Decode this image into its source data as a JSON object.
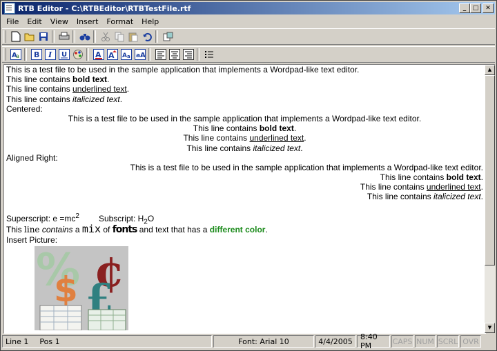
{
  "window": {
    "title": "RTB Editor - C:\\RTBEditor\\RTBTestFile.rtf",
    "minimize": "_",
    "maximize": "□",
    "close": "✕"
  },
  "menu": [
    "File",
    "Edit",
    "View",
    "Insert",
    "Format",
    "Help"
  ],
  "toolbar1": [
    "new-icon",
    "open-icon",
    "save-icon",
    "print-icon",
    "find-icon",
    "cut-icon",
    "copy-icon",
    "paste-icon",
    "undo-icon",
    "insert-object-icon"
  ],
  "toolbar2": [
    "font-icon",
    "bold-icon",
    "italic-icon",
    "underline-icon",
    "color-icon",
    "text-color-icon",
    "font-size-up-icon",
    "font-size-down-icon",
    "font-select-icon",
    "align-left-icon",
    "align-center-icon",
    "align-right-icon",
    "bullets-icon"
  ],
  "doc": {
    "l1": "This is a test file to be used in the sample application that implements a Wordpad-like text editor.",
    "contains": "This line contains ",
    "bold": "bold text",
    "underlined": "underlined text",
    "italic": "italicized text",
    "dot": ".",
    "centered": "Centered:",
    "right": "Aligned Right:",
    "sup_label": "Superscript: e =mc",
    "sup": "2",
    "sub_label": "Subscript: H",
    "sub": "2",
    "sub_tail": "O",
    "mix1": "This ",
    "mix2": "line",
    "mix3": " contains",
    "mix4": " a ",
    "mix5": "mix",
    "mix6": " of ",
    "mix7": "fonts",
    "mix8": " and text that has a ",
    "mix9": "different color",
    "mix10": ".",
    "insert": "Insert Picture:",
    "green": "#1a8a1a"
  },
  "status": {
    "line": "Line 1",
    "pos": "Pos 1",
    "font": "Font: Arial 10",
    "date": "4/4/2005",
    "time": "8:40 PM",
    "caps": "CAPS",
    "num": "NUM",
    "scrl": "SCRL",
    "ovr": "OVR"
  }
}
